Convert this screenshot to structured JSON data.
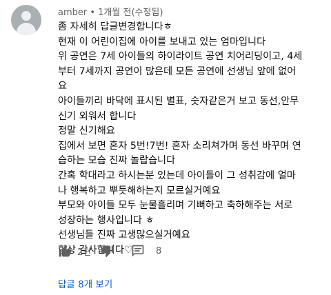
{
  "comment": {
    "header": "amber • 1개월 전(수정됨)",
    "lines": [
      "좀 자세히 답글변경합니다ㅎ",
      "현재 이 어린이집에 아이를 보내고 있는 엄마입니다",
      "위 공연은 7세 아이들의 하이라이트 공연 치어리딩이고, 4세",
      "부터 7세까지 공연이 많은데 모든 공연에 선생님 앞에 없어",
      "요",
      "아이들끼리 바닥에 표시된 별표, 숫자같은거 보고  동선,안무",
      "신기 외워서 합니다",
      "정말 신기해요",
      "집에서 보면 혼자 5번!7번! 혼자 소리쳐가며 동선 바꾸며 연",
      "습하는 모습 진짜 놀랍습니다",
      "간혹 학대라고 하시는분 있는데 아이들이 그 성취감에 얼마",
      "나 행복하고 뿌듯해하는지 모르실거예요",
      "부모와 아이들 모두 눈물흘리며 기뻐하고 축하해주는 서로",
      "성장하는 행사입니다 ㅎ",
      "선생님들 진짜 고생많으실거예요",
      "항상 감사합니다♡"
    ]
  },
  "actions": {
    "like_count": "2천",
    "reply_count": "8"
  },
  "replies_link": "답글 8개 보기",
  "icons": {
    "like": "thumbs-up-icon",
    "dislike": "thumbs-down-icon",
    "reply": "comment-icon"
  },
  "colors": {
    "link": "#065fd4",
    "secondary_text": "#606060"
  }
}
